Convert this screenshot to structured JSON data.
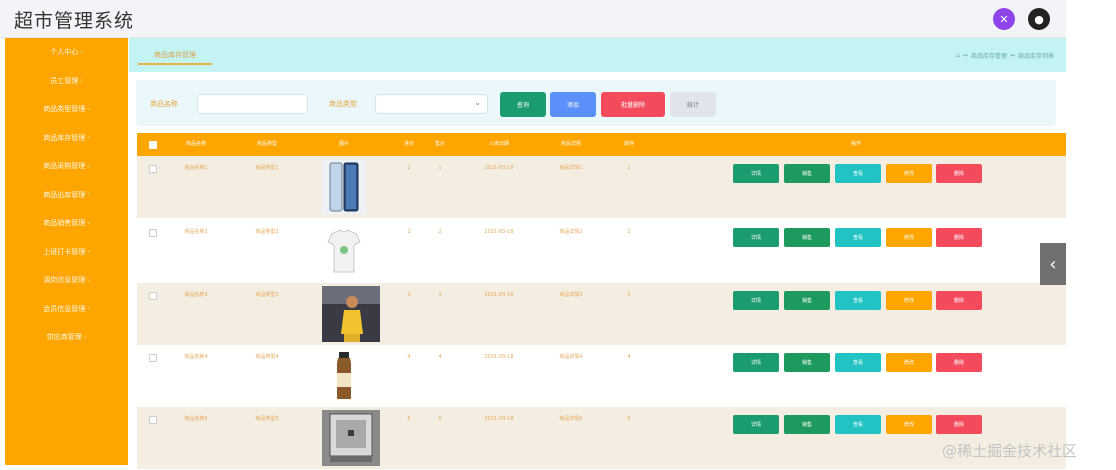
{
  "app": {
    "title": "超市管理系统"
  },
  "header": {
    "icon_left": "✕",
    "icon_right": "●"
  },
  "sidebar": {
    "items": [
      {
        "label": "个人中心"
      },
      {
        "label": "员工管理"
      },
      {
        "label": "商品类型管理"
      },
      {
        "label": "商品库存管理"
      },
      {
        "label": "商品采购管理"
      },
      {
        "label": "商品出库管理"
      },
      {
        "label": "商品销售管理"
      },
      {
        "label": "上班打卡管理"
      },
      {
        "label": "调岗信息管理"
      },
      {
        "label": "会员信息管理"
      },
      {
        "label": "供应商管理"
      }
    ]
  },
  "tabs": {
    "active_label": "商品库存管理"
  },
  "breadcrumb": {
    "home_icon": "⌂",
    "sep": "↔",
    "level1": "商品库存管理",
    "level2": "商品库存列表"
  },
  "search": {
    "name_label": "商品名称",
    "name_value": "",
    "type_label": "商品类型",
    "type_value": "",
    "buttons": {
      "query": "查询",
      "add": "添加",
      "batch_delete": "批量删除",
      "stats": "统计"
    }
  },
  "table": {
    "headers": [
      "商品名称",
      "商品类型",
      "图片",
      "进价",
      "售价",
      "入库日期",
      "商品详情",
      "库存",
      "操作"
    ],
    "actions": {
      "detail": "详情",
      "sale": "销售",
      "view": "查看",
      "edit": "修改",
      "delete": "删除"
    },
    "rows": [
      {
        "name": "商品名称1",
        "type": "商品类型1",
        "image": "phone",
        "cost": "1",
        "price": "1",
        "date": "2021-03-18",
        "desc": "商品详情1",
        "stock": "1"
      },
      {
        "name": "商品名称2",
        "type": "商品类型2",
        "image": "tshirt",
        "cost": "2",
        "price": "2",
        "date": "2021-03-18",
        "desc": "商品详情2",
        "stock": "2"
      },
      {
        "name": "商品名称3",
        "type": "商品类型3",
        "image": "dress",
        "cost": "3",
        "price": "3",
        "date": "2021-03-18",
        "desc": "商品详情3",
        "stock": "3"
      },
      {
        "name": "商品名称4",
        "type": "商品类型4",
        "image": "bottle",
        "cost": "4",
        "price": "4",
        "date": "2021-03-18",
        "desc": "商品详情4",
        "stock": "4"
      },
      {
        "name": "商品名称5",
        "type": "商品类型5",
        "image": "appliance",
        "cost": "5",
        "price": "5",
        "date": "2021-03-18",
        "desc": "商品详情5",
        "stock": "5"
      }
    ]
  },
  "side_handle": "‹",
  "watermark": "@稀土掘金技术社区",
  "colors": {
    "orange": "#ffa500",
    "teal_tab": "#c4f3f3",
    "search_bg": "#eaf8fb",
    "row_alt": "#f4ede1"
  }
}
